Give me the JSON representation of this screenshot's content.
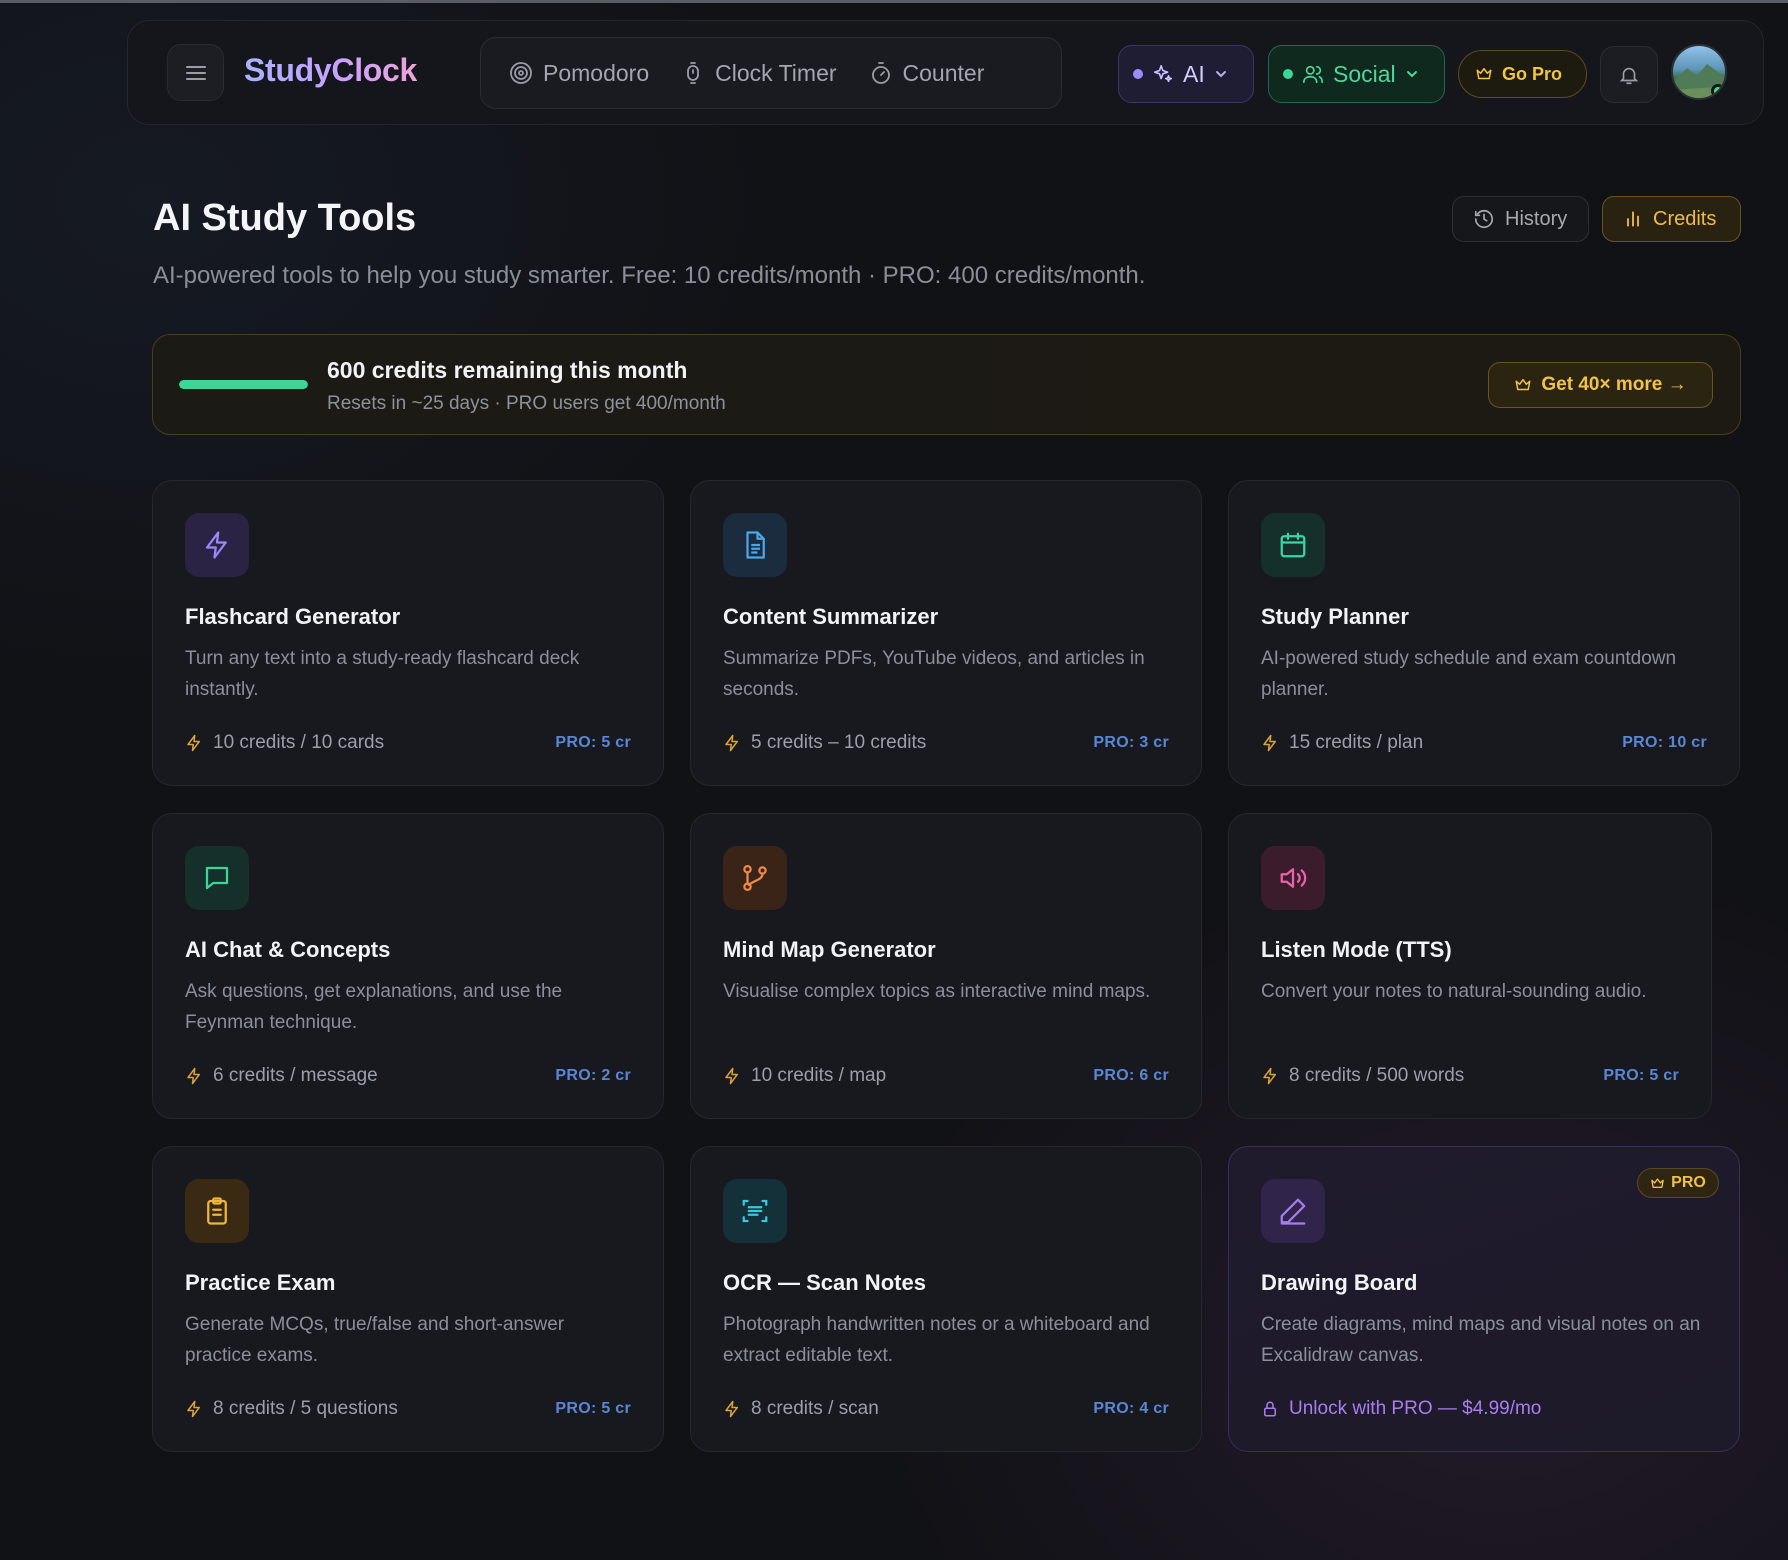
{
  "app": {
    "brand": "StudyClock",
    "modes": [
      {
        "label": "Pomodoro",
        "icon": "target-icon"
      },
      {
        "label": "Clock Timer",
        "icon": "hourglass-icon"
      },
      {
        "label": "Counter",
        "icon": "stopwatch-icon"
      }
    ],
    "ai_menu": "AI",
    "social_menu": "Social",
    "go_pro": "Go Pro"
  },
  "header": {
    "title": "AI Study Tools",
    "subtitle": "AI-powered tools to help you study smarter. Free: 10 credits/month · PRO: 400 credits/month.",
    "history": "History",
    "credits": "Credits"
  },
  "banner": {
    "title": "600 credits remaining this month",
    "subtitle": "Resets in ~25 days · PRO users get 400/month",
    "cta": "Get 40× more →",
    "progress": 1.0
  },
  "colors": {
    "accent_gold": "#f2c443",
    "accent_green": "#3ad69a",
    "accent_purple": "#a77ef0",
    "pro_blue": "#5a86d6"
  },
  "tools": [
    {
      "title": "Flashcard Generator",
      "desc": "Turn any text into a study-ready flashcard deck instantly.",
      "cost": "10 credits / 10 cards",
      "pro": "PRO: 5 cr",
      "icon": "lightning-icon"
    },
    {
      "title": "Content Summarizer",
      "desc": "Summarize PDFs, YouTube videos, and articles in seconds.",
      "cost": "5 credits – 10 credits",
      "pro": "PRO: 3 cr",
      "icon": "document-icon"
    },
    {
      "title": "Study Planner",
      "desc": "AI-powered study schedule and exam countdown planner.",
      "cost": "15 credits / plan",
      "pro": "PRO: 10 cr",
      "icon": "calendar-icon"
    },
    {
      "title": "AI Chat & Concepts",
      "desc": "Ask questions, get explanations, and use the Feynman technique.",
      "cost": "6 credits / message",
      "pro": "PRO: 2 cr",
      "icon": "chat-icon"
    },
    {
      "title": "Mind Map Generator",
      "desc": "Visualise complex topics as interactive mind maps.",
      "cost": "10 credits / map",
      "pro": "PRO: 6 cr",
      "icon": "git-branch-icon"
    },
    {
      "title": "Listen Mode (TTS)",
      "desc": "Convert your notes to natural-sounding audio.",
      "cost": "8 credits / 500 words",
      "pro": "PRO: 5 cr",
      "icon": "speaker-icon"
    },
    {
      "title": "Practice Exam",
      "desc": "Generate MCQs, true/false and short-answer practice exams.",
      "cost": "8 credits / 5 questions",
      "pro": "PRO: 5 cr",
      "icon": "clipboard-icon"
    },
    {
      "title": "OCR — Scan Notes",
      "desc": "Photograph handwritten notes or a whiteboard and extract editable text.",
      "cost": "8 credits / scan",
      "pro": "PRO: 4 cr",
      "icon": "scan-icon"
    },
    {
      "title": "Drawing Board",
      "desc": "Create diagrams, mind maps and visual notes on an Excalidraw canvas.",
      "unlock": "Unlock with PRO — $4.99/mo",
      "badge": "PRO",
      "icon": "pen-icon"
    }
  ]
}
